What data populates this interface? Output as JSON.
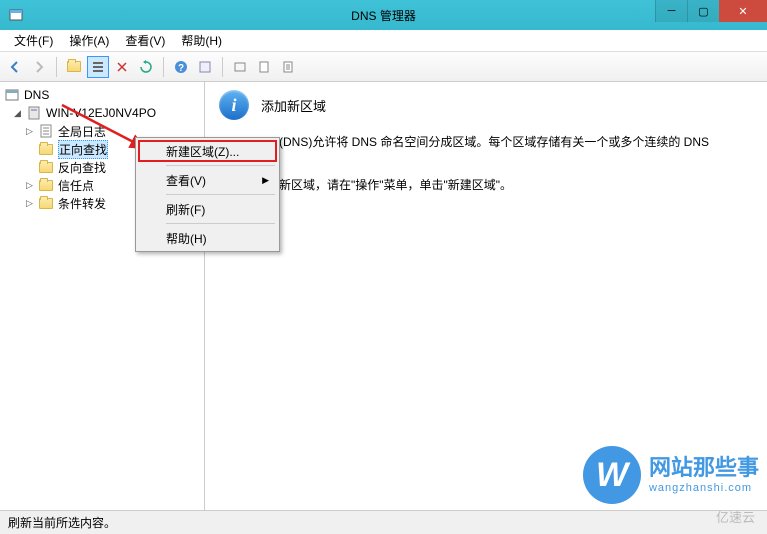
{
  "title": "DNS 管理器",
  "menubar": {
    "file": "文件(F)",
    "action": "操作(A)",
    "view": "查看(V)",
    "help": "帮助(H)"
  },
  "tree": {
    "root": "DNS",
    "server": "WIN-V12EJ0NV4PO",
    "globalLog": "全局日志",
    "fwdLookup": "正向查找",
    "revLookup": "反向查找",
    "trustPoint": "信任点",
    "condFwd": "条件转发"
  },
  "contextMenu": {
    "newZone": "新建区域(Z)...",
    "view": "查看(V)",
    "refresh": "刷新(F)",
    "help": "帮助(H)"
  },
  "detail": {
    "heading": "添加新区域",
    "line1": "(DNS)允许将 DNS 命名空间分成区域。每个区域存储有关一个或多个连续的 DNS",
    "line2": "新区域，请在\"操作\"菜单，单击\"新建区域\"。"
  },
  "statusbar": "刷新当前所选内容。",
  "watermark": {
    "letter": "W",
    "main": "网站那些事",
    "sub": "wangzhanshi.com",
    "corner": "亿速云"
  }
}
